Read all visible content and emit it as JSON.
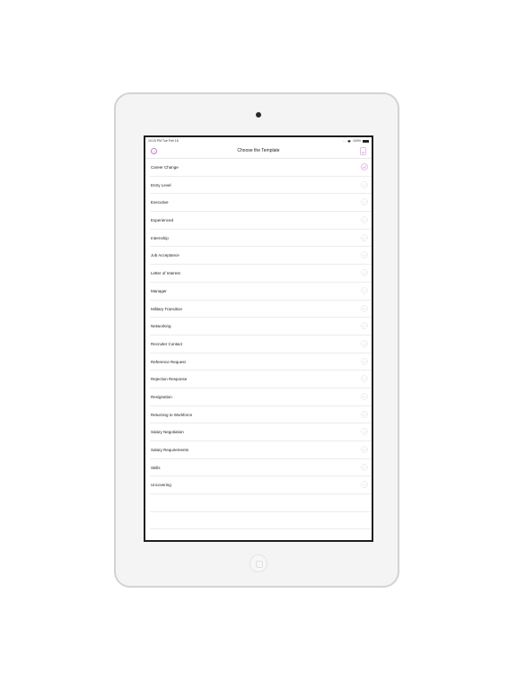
{
  "status_bar": {
    "time_date": "10:15 PM   Tue Feb 18",
    "signal": "...",
    "battery_percent": "100%"
  },
  "nav": {
    "title": "Choose the Template",
    "back_icon": "back-circle-icon",
    "action_icon": "document-icon"
  },
  "colors": {
    "accent": "#c77dce",
    "unchecked": "#cfcfcf",
    "separator": "#ececec",
    "bezel": "#f4f4f4"
  },
  "templates": [
    {
      "label": "Career Change",
      "selected": true
    },
    {
      "label": "Entry Level",
      "selected": false
    },
    {
      "label": "Executive",
      "selected": false
    },
    {
      "label": "Experienced",
      "selected": false
    },
    {
      "label": "Internship",
      "selected": false
    },
    {
      "label": "Job Acceptance",
      "selected": false
    },
    {
      "label": "Letter of Interest",
      "selected": false
    },
    {
      "label": "Manager",
      "selected": false
    },
    {
      "label": "Military Transition",
      "selected": false
    },
    {
      "label": "Networking",
      "selected": false
    },
    {
      "label": "Recruiter Contact",
      "selected": false
    },
    {
      "label": "Reference Request",
      "selected": false
    },
    {
      "label": "Rejection Response",
      "selected": false
    },
    {
      "label": "Resignation",
      "selected": false
    },
    {
      "label": "Returning to Workforce",
      "selected": false
    },
    {
      "label": "Salary Negotiation",
      "selected": false
    },
    {
      "label": "Salary Requirements",
      "selected": false
    },
    {
      "label": "Skills",
      "selected": false
    },
    {
      "label": "Uncovering",
      "selected": false
    }
  ]
}
